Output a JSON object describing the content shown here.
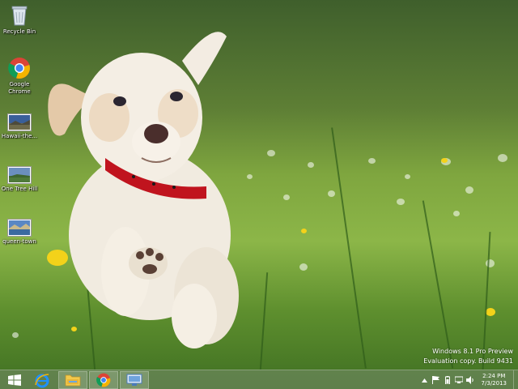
{
  "desktop": {
    "icons": [
      {
        "label": "Recycle Bin",
        "icon": "recycle-bin-icon"
      },
      {
        "label": "Google Chrome",
        "icon": "chrome-icon"
      },
      {
        "label": "Hawaii-the...",
        "icon": "image-file-icon"
      },
      {
        "label": "One Tree Hill",
        "icon": "image-file-icon"
      },
      {
        "label": "queen-town",
        "icon": "image-file-icon"
      }
    ],
    "chrome_label_lines": [
      "Google",
      "Chrome"
    ]
  },
  "watermark": {
    "line1": "Windows 8.1 Pro Preview",
    "line2": "Evaluation copy. Build 9431"
  },
  "taskbar": {
    "buttons": [
      {
        "name": "start",
        "icon": "windows-logo-icon"
      },
      {
        "name": "internet-explorer",
        "icon": "ie-icon"
      },
      {
        "name": "file-explorer",
        "icon": "folder-icon"
      },
      {
        "name": "chrome",
        "icon": "chrome-icon"
      },
      {
        "name": "remote-desktop",
        "icon": "network-computer-icon"
      }
    ],
    "tray_icons": [
      "chevron-up-icon",
      "flag-icon",
      "battery-icon",
      "network-icon",
      "speaker-icon"
    ],
    "clock": {
      "time": "2:24 PM",
      "date": "7/3/2013"
    }
  },
  "colors": {
    "accent_blue": "#1e90ff",
    "chrome_red": "#db4437",
    "chrome_yellow": "#f4b400",
    "chrome_green": "#0f9d58",
    "collar_red": "#c0141e"
  }
}
